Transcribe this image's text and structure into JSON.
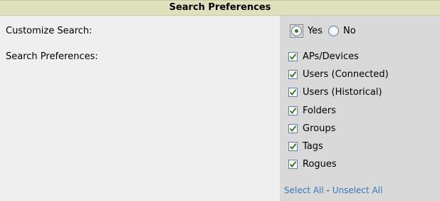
{
  "panel": {
    "title": "Search Preferences"
  },
  "customize": {
    "label": "Customize Search:",
    "options": [
      {
        "label": "Yes",
        "selected": true
      },
      {
        "label": "No",
        "selected": false
      }
    ]
  },
  "preferences": {
    "label": "Search Preferences:",
    "items": [
      {
        "label": "APs/Devices",
        "checked": true
      },
      {
        "label": "Users (Connected)",
        "checked": true
      },
      {
        "label": "Users (Historical)",
        "checked": true
      },
      {
        "label": "Folders",
        "checked": true
      },
      {
        "label": "Groups",
        "checked": true
      },
      {
        "label": "Tags",
        "checked": true
      },
      {
        "label": "Rogues",
        "checked": true
      }
    ]
  },
  "links": {
    "select_all": "Select All",
    "separator": " - ",
    "unselect_all": "Unselect All"
  },
  "colors": {
    "header_bg": "#dfe1bd",
    "left_bg": "#efefef",
    "right_bg": "#d9d9d9",
    "link": "#3877b9",
    "check": "#3a7a24"
  }
}
